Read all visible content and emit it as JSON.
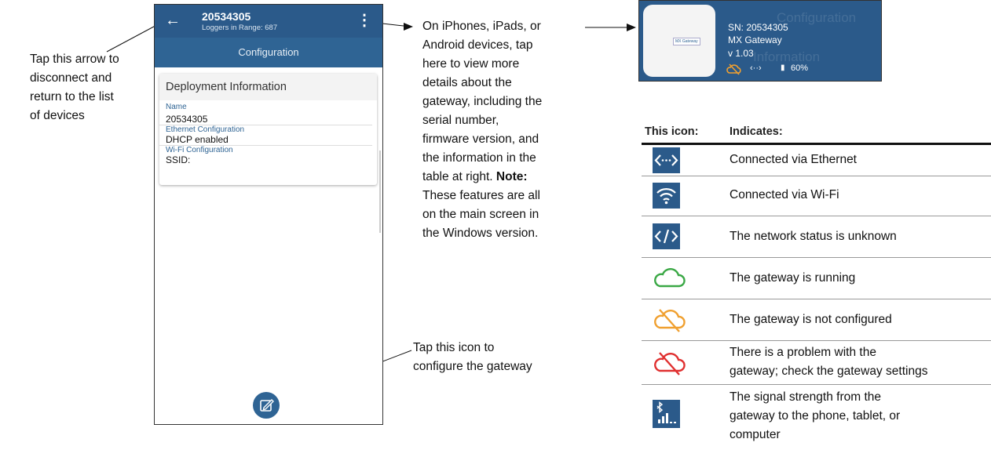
{
  "callouts": {
    "left": [
      "Tap this arrow to",
      "disconnect and",
      "return to the list",
      "of devices"
    ],
    "right_lines": [
      "On iPhones, iPads, or",
      "Android devices, tap",
      "here to view more",
      "details about the",
      "gateway, including the",
      "serial number,",
      "firmware version, and",
      "the information in the",
      "table at right."
    ],
    "right_note_label": "Note:",
    "right_note_lines": [
      "These features are all",
      "on the main screen in",
      "the Windows version."
    ],
    "bottom": [
      "Tap this icon to",
      "configure the gateway"
    ]
  },
  "phone": {
    "title": "20534305",
    "subtitle": "Loggers in Range: 687",
    "tab": "Configuration",
    "card_title": "Deployment Information",
    "fields": [
      {
        "label": "Name",
        "value": "20534305"
      },
      {
        "label": "Ethernet Configuration",
        "value": "DHCP enabled"
      },
      {
        "label": "Wi-Fi Configuration",
        "value": "SSID:"
      }
    ],
    "icons": {
      "back": "arrow-left-icon",
      "more": "more-vertical-icon",
      "edit": "edit-icon"
    },
    "colors": {
      "appbar": "#2b5a8a",
      "subbar": "#2f6494"
    }
  },
  "gateway": {
    "device_label": "MX Gateway",
    "sn": "SN: 20534305",
    "model": "MX Gateway",
    "version": "v 1.03",
    "signal": "60%",
    "ghost_1": "Configuration",
    "ghost_2": "Information"
  },
  "table": {
    "header_icon": "This icon:",
    "header_text": "Indicates:",
    "rows": [
      {
        "icon": "ethernet-icon",
        "lines": [
          "Connected via Ethernet"
        ]
      },
      {
        "icon": "wifi-icon",
        "lines": [
          "Connected via Wi-Fi"
        ]
      },
      {
        "icon": "network-unknown-icon",
        "lines": [
          "The network status is unknown"
        ]
      },
      {
        "icon": "cloud-green-icon",
        "lines": [
          "The gateway is running"
        ]
      },
      {
        "icon": "cloud-orange-slash-icon",
        "lines": [
          "The gateway is not configured"
        ]
      },
      {
        "icon": "cloud-red-slash-icon",
        "lines": [
          "There is a problem with the",
          "gateway; check the gateway settings"
        ]
      },
      {
        "icon": "bluetooth-signal-icon",
        "lines": [
          "The signal strength from the",
          "gateway to the phone, tablet, or",
          "computer"
        ]
      }
    ],
    "colors": {
      "green": "#3aa845",
      "orange": "#f0a030",
      "red": "#e03030",
      "icon_bg": "#2b5a8a"
    }
  }
}
